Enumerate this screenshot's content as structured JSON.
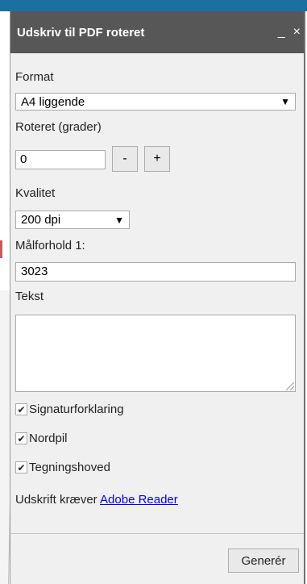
{
  "dialog": {
    "title": "Udskriv til PDF roteret",
    "minimize_glyph": "_",
    "close_glyph": "×"
  },
  "format": {
    "label": "Format",
    "selected": "A4 liggende",
    "arrow": "▼"
  },
  "rotation": {
    "label": "Roteret (grader)",
    "value": "0",
    "minus_label": "-",
    "plus_label": "+"
  },
  "quality": {
    "label": "Kvalitet",
    "selected": "200 dpi",
    "arrow": "▼"
  },
  "scale": {
    "label": "Målforhold 1:",
    "value": "3023"
  },
  "text": {
    "label": "Tekst",
    "value": ""
  },
  "checkboxes": [
    {
      "label": "Signaturforklaring",
      "checked": true,
      "mark": "✔"
    },
    {
      "label": "Nordpil",
      "checked": true,
      "mark": "✔"
    },
    {
      "label": "Tegningshoved",
      "checked": true,
      "mark": "✔"
    }
  ],
  "requirement": {
    "text": "Udskrift kræver",
    "link": "Adobe Reader"
  },
  "generate_button": "Generér",
  "colors": {
    "titlebar": "#575757",
    "panel": "#f0f0f0",
    "link": "#0000ee",
    "map_strip": "#1a6fa3"
  }
}
